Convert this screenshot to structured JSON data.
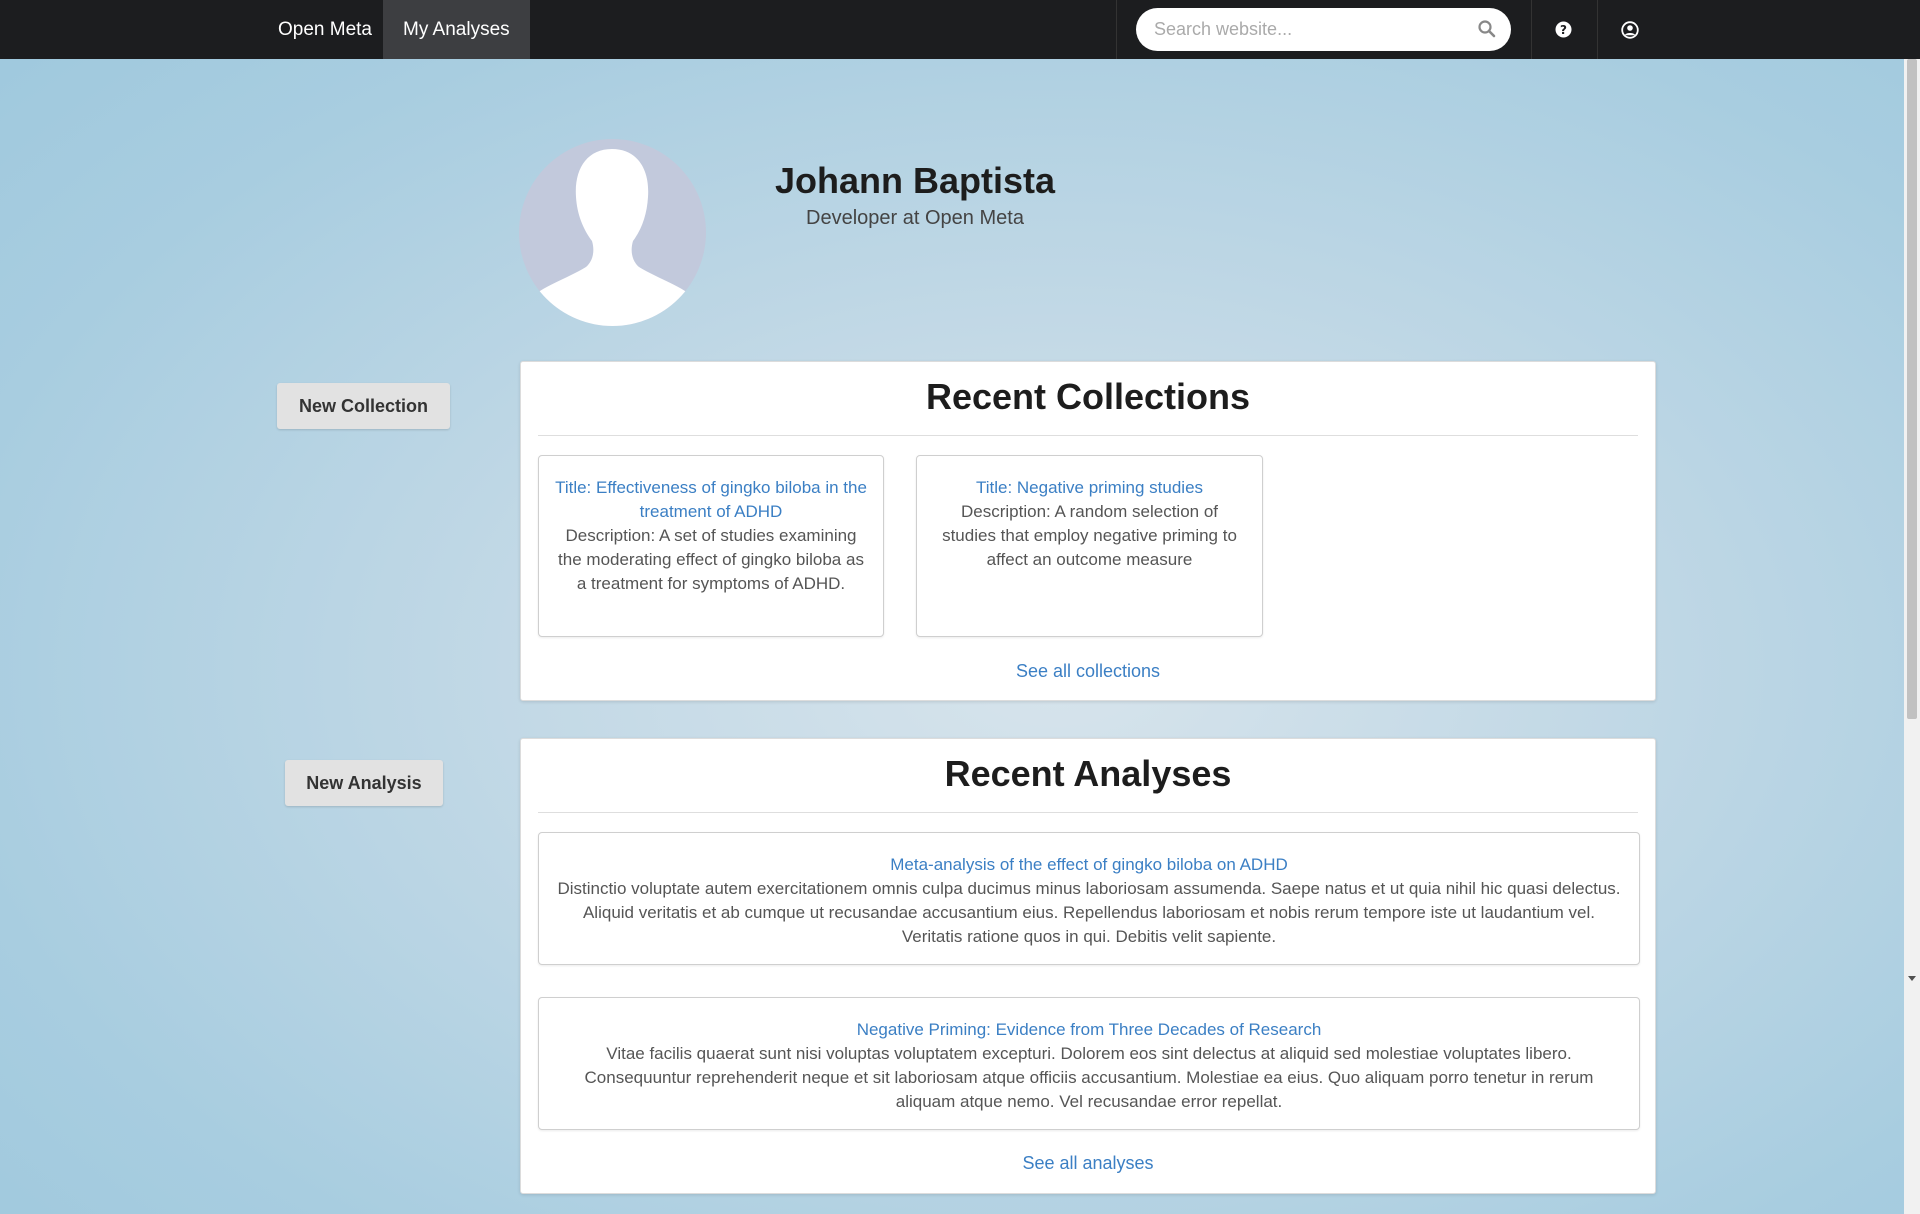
{
  "navbar": {
    "brand": "Open Meta",
    "active_tab": "My Analyses",
    "search": {
      "placeholder": "Search website...",
      "value": ""
    },
    "icons": [
      "search-icon",
      "help-icon",
      "user-account-icon"
    ]
  },
  "profile": {
    "name": "Johann Baptista",
    "title": "Developer at Open Meta",
    "avatar_icon": "person-silhouette-icon"
  },
  "actions": {
    "new_collection": "New Collection",
    "new_analysis": "New Analysis"
  },
  "collections": {
    "heading": "Recent Collections",
    "items": [
      {
        "title": "Title: Effectiveness of gingko biloba in the treatment of ADHD",
        "description": "Description: A set of studies examining the moderating effect of gingko biloba as a treatment for symptoms of ADHD."
      },
      {
        "title": "Title: Negative priming studies",
        "description": "Description: A random selection of studies that employ negative priming to affect an outcome measure"
      }
    ],
    "see_all": "See all collections"
  },
  "analyses": {
    "heading": "Recent Analyses",
    "items": [
      {
        "title": "Meta-analysis of the effect of gingko biloba on ADHD",
        "description": "Distinctio voluptate autem exercitationem omnis culpa ducimus minus laboriosam assumenda. Saepe natus et ut quia nihil hic quasi delectus. Aliquid veritatis et ab cumque ut recusandae accusantium eius. Repellendus laboriosam et nobis rerum tempore iste ut laudantium vel. Veritatis ratione quos in qui. Debitis velit sapiente."
      },
      {
        "title": "Negative Priming: Evidence from Three Decades of Research",
        "description": "Vitae facilis quaerat sunt nisi voluptas voluptatem excepturi. Dolorem eos sint delectus at aliquid sed molestiae voluptates libero. Consequuntur reprehenderit neque et sit laboriosam atque officiis accusantium. Molestiae ea eius. Quo aliquam porro tenetur in rerum aliquam atque nemo. Vel recusandae error repellat."
      }
    ],
    "see_all": "See all analyses"
  },
  "colors": {
    "navbar": "#1c1d1f",
    "active_tab": "#3d3e41",
    "link": "#3b7fc4",
    "avatar_bg": "#c2c9dc"
  }
}
